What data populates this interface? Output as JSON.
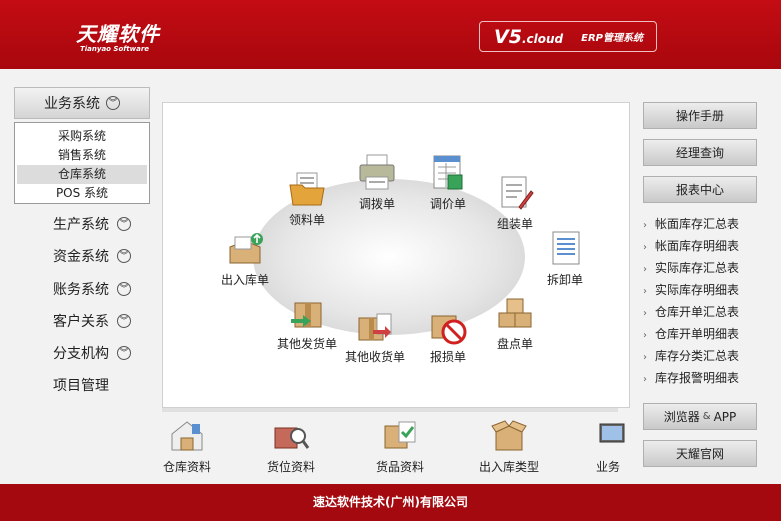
{
  "header": {
    "logo_cn": "天耀软件",
    "logo_en": "Tianyao Software",
    "version_main": "V5",
    "version_suffix": ".cloud",
    "version_product": "ERP管理系统"
  },
  "left_nav": {
    "current_section": "业务系统",
    "submenu": [
      "采购系统",
      "销售系统",
      "仓库系统",
      "POS 系统"
    ],
    "active_submenu_index": 2,
    "sections": [
      "生产系统",
      "资金系统",
      "账务系统",
      "客户关系",
      "分支机构",
      "项目管理"
    ]
  },
  "main": {
    "nodes": {
      "lingliao": "领料单",
      "diaobo": "调拨单",
      "diaojia": "调价单",
      "zuzhuang": "组装单",
      "chairu": "出入库单",
      "chaixie": "拆卸单",
      "qitafahuo": "其他发货单",
      "qitashouhuo": "其他收货单",
      "baosun": "报损单",
      "pandian": "盘点单"
    }
  },
  "bottom_strip": [
    "仓库资料",
    "货位资料",
    "货品资料",
    "出入库类型",
    "业务"
  ],
  "right_panel": {
    "manual": "操作手册",
    "manager_query": "经理查询",
    "report_center": "报表中心",
    "reports": [
      "帐面库存汇总表",
      "帐面库存明细表",
      "实际库存汇总表",
      "实际库存明细表",
      "仓库开单汇总表",
      "仓库开单明细表",
      "库存分类汇总表",
      "库存报警明细表"
    ],
    "browser_label": "浏览器",
    "browser_amp": "&",
    "browser_app": "APP",
    "official_site": "天耀官网"
  },
  "footer": {
    "company": "速达软件技术(广州)有限公司"
  },
  "colors": {
    "brand_red": "#b00a10",
    "footer_red": "#a4090f"
  }
}
